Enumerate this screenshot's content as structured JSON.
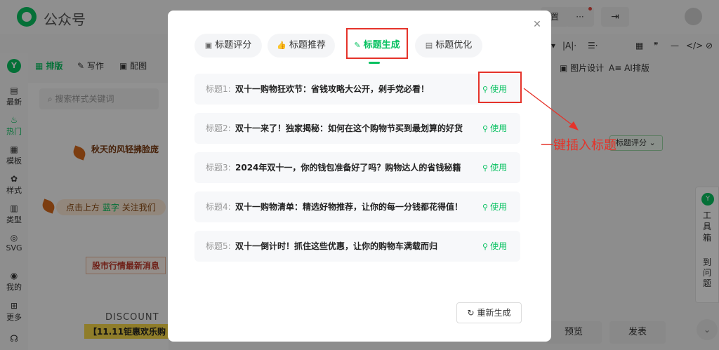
{
  "app": {
    "title": "公众号"
  },
  "topbar": {
    "settings_fragment": "置",
    "more_label": "···"
  },
  "leftnav": {
    "brand": "Y",
    "items": [
      {
        "label": "最新",
        "icon": "news-icon"
      },
      {
        "label": "热门",
        "icon": "fire-icon"
      },
      {
        "label": "模板",
        "icon": "template-icon"
      },
      {
        "label": "样式",
        "icon": "style-icon"
      },
      {
        "label": "类型",
        "icon": "type-icon"
      },
      {
        "label": "SVG",
        "icon": "svg-icon"
      },
      {
        "label": "我的",
        "icon": "user-icon"
      },
      {
        "label": "更多",
        "icon": "grid-icon"
      }
    ]
  },
  "subtabs": [
    "排版",
    "写作",
    "配图"
  ],
  "search": {
    "placeholder": "搜索样式关键词"
  },
  "templates": {
    "t1": "秋天的风轻拂脸庞",
    "t2_prefix": "点击上方",
    "t2_highlight": "蓝字",
    "t2_suffix": "关注我们",
    "t3": "股市行情最新消息",
    "t4a": "DISCOUNT",
    "t4b": "【11.11钜惠欢乐购"
  },
  "right_toolbar": {
    "items": [
      "|A|·",
      "☰·",
      "▦",
      "❞",
      "—",
      "</>",
      "⊘"
    ],
    "image_design": "图片设计",
    "ai_layout": "AI排版",
    "title_score_chip": "标题评分",
    "toolbox": "工具箱",
    "to_question": "到问题",
    "preview": "预览",
    "publish": "发表"
  },
  "modal": {
    "tabs": [
      {
        "label": "标题评分",
        "icon": "score-icon"
      },
      {
        "label": "标题推荐",
        "icon": "thumb-icon"
      },
      {
        "label": "标题生成",
        "icon": "magic-wand-icon"
      },
      {
        "label": "标题优化",
        "icon": "optimize-icon"
      }
    ],
    "active_tab": "标题生成",
    "titles": [
      {
        "num": "标题1:",
        "text": "双十一购物狂欢节：省钱攻略大公开，剁手党必看！"
      },
      {
        "num": "标题2:",
        "text": "双十一来了！独家揭秘：如何在这个购物节买到最划算的好货"
      },
      {
        "num": "标题3:",
        "text": "2024年双十一，你的钱包准备好了吗？购物达人的省钱秘籍"
      },
      {
        "num": "标题4:",
        "text": "双十一购物清单：精选好物推荐，让你的每一分钱都花得值！"
      },
      {
        "num": "标题5:",
        "text": "双十一倒计时！抓住这些优惠，让你的购物车满载而归"
      }
    ],
    "use_label": "使用",
    "regenerate_label": "重新生成"
  },
  "annotation": {
    "text": "一键插入标题",
    "color": "#e5332a"
  },
  "colors": {
    "accent": "#07c160",
    "highlight": "#e5332a"
  }
}
